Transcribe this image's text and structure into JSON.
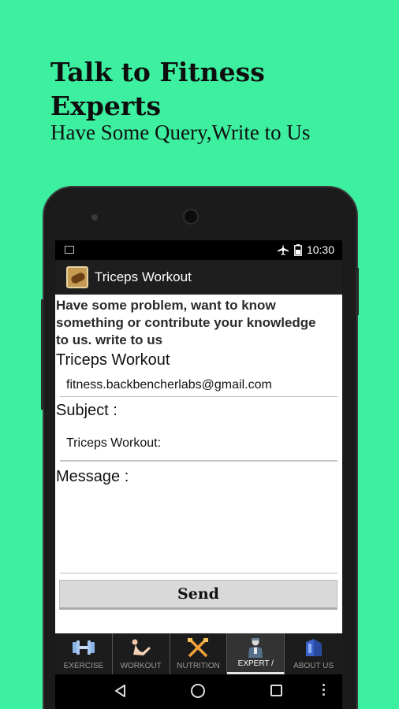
{
  "promo": {
    "title": "Talk to Fitness Experts",
    "subtitle": "Have Some Query,Write to Us"
  },
  "status_bar": {
    "time": "10:30"
  },
  "action_bar": {
    "title": "Triceps Workout"
  },
  "form": {
    "intro": "Have some problem, want to know something or contribute your knowledge to us. write to us",
    "to_label": "Triceps Workout",
    "email_value": "fitness.backbencherlabs@gmail.com",
    "subject_label": "Subject :",
    "subject_value": "Triceps Workout:",
    "message_label": "Message :",
    "message_value": "",
    "send_label": "Send"
  },
  "tabs": [
    {
      "label": "EXERCISE",
      "icon": "dumbbell-icon",
      "active": false
    },
    {
      "label": "WORKOUT",
      "icon": "situp-icon",
      "active": false
    },
    {
      "label": "NUTRITION",
      "icon": "fork-knife-icon",
      "active": false
    },
    {
      "label": "EXPERT /",
      "icon": "expert-icon",
      "active": true
    },
    {
      "label": "ABOUT US",
      "icon": "about-icon",
      "active": false
    }
  ],
  "colors": {
    "background": "#3cf0a0",
    "tab_active_indicator": "#e6e6e6"
  }
}
